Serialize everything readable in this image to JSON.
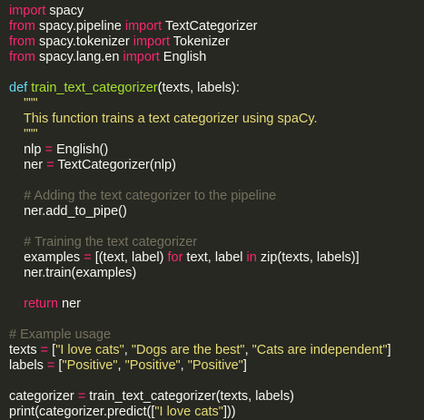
{
  "theme": {
    "background": "#272822",
    "foreground": "#f8f8f2",
    "keyword": "#f92672",
    "storage": "#66d9ef",
    "function": "#a6e22e",
    "string": "#e6db74",
    "comment": "#75715e"
  },
  "code": {
    "lines": [
      [
        {
          "t": "kw",
          "v": "import"
        },
        {
          "t": "pl",
          "v": " spacy"
        }
      ],
      [
        {
          "t": "kw",
          "v": "from"
        },
        {
          "t": "pl",
          "v": " spacy.pipeline "
        },
        {
          "t": "kw",
          "v": "import"
        },
        {
          "t": "pl",
          "v": " TextCategorizer"
        }
      ],
      [
        {
          "t": "kw",
          "v": "from"
        },
        {
          "t": "pl",
          "v": " spacy.tokenizer "
        },
        {
          "t": "kw",
          "v": "import"
        },
        {
          "t": "pl",
          "v": " Tokenizer"
        }
      ],
      [
        {
          "t": "kw",
          "v": "from"
        },
        {
          "t": "pl",
          "v": " spacy.lang.en "
        },
        {
          "t": "kw",
          "v": "import"
        },
        {
          "t": "pl",
          "v": " English"
        }
      ],
      [],
      [
        {
          "t": "def",
          "v": "def"
        },
        {
          "t": "pl",
          "v": " "
        },
        {
          "t": "fn",
          "v": "train_text_categorizer"
        },
        {
          "t": "pl",
          "v": "(texts, labels):"
        }
      ],
      [
        {
          "t": "str",
          "v": "    \"\"\""
        }
      ],
      [
        {
          "t": "str",
          "v": "    This function trains a text categorizer using spaCy."
        }
      ],
      [
        {
          "t": "str",
          "v": "    \"\"\""
        }
      ],
      [
        {
          "t": "pl",
          "v": "    nlp "
        },
        {
          "t": "op",
          "v": "="
        },
        {
          "t": "pl",
          "v": " English()"
        }
      ],
      [
        {
          "t": "pl",
          "v": "    ner "
        },
        {
          "t": "op",
          "v": "="
        },
        {
          "t": "pl",
          "v": " TextCategorizer(nlp)"
        }
      ],
      [],
      [
        {
          "t": "cm",
          "v": "    # Adding the text categorizer to the pipeline"
        }
      ],
      [
        {
          "t": "pl",
          "v": "    ner.add_to_pipe()"
        }
      ],
      [],
      [
        {
          "t": "cm",
          "v": "    # Training the text categorizer"
        }
      ],
      [
        {
          "t": "pl",
          "v": "    examples "
        },
        {
          "t": "op",
          "v": "="
        },
        {
          "t": "pl",
          "v": " [(text, label) "
        },
        {
          "t": "kw",
          "v": "for"
        },
        {
          "t": "pl",
          "v": " text, label "
        },
        {
          "t": "kw",
          "v": "in"
        },
        {
          "t": "pl",
          "v": " zip(texts, labels)]"
        }
      ],
      [
        {
          "t": "pl",
          "v": "    ner.train(examples)"
        }
      ],
      [],
      [
        {
          "t": "pl",
          "v": "    "
        },
        {
          "t": "kw",
          "v": "return"
        },
        {
          "t": "pl",
          "v": " ner"
        }
      ],
      [],
      [
        {
          "t": "cm",
          "v": "# Example usage"
        }
      ],
      [
        {
          "t": "pl",
          "v": "texts "
        },
        {
          "t": "op",
          "v": "="
        },
        {
          "t": "pl",
          "v": " ["
        },
        {
          "t": "str",
          "v": "\"I love cats\""
        },
        {
          "t": "pl",
          "v": ", "
        },
        {
          "t": "str",
          "v": "\"Dogs are the best\""
        },
        {
          "t": "pl",
          "v": ", "
        },
        {
          "t": "str",
          "v": "\"Cats are independent\""
        },
        {
          "t": "pl",
          "v": "]"
        }
      ],
      [
        {
          "t": "pl",
          "v": "labels "
        },
        {
          "t": "op",
          "v": "="
        },
        {
          "t": "pl",
          "v": " ["
        },
        {
          "t": "str",
          "v": "\"Positive\""
        },
        {
          "t": "pl",
          "v": ", "
        },
        {
          "t": "str",
          "v": "\"Positive\""
        },
        {
          "t": "pl",
          "v": ", "
        },
        {
          "t": "str",
          "v": "\"Positive\""
        },
        {
          "t": "pl",
          "v": "]"
        }
      ],
      [],
      [
        {
          "t": "pl",
          "v": "categorizer "
        },
        {
          "t": "op",
          "v": "="
        },
        {
          "t": "pl",
          "v": " train_text_categorizer(texts, labels)"
        }
      ],
      [
        {
          "t": "pl",
          "v": "print(categorizer.predict(["
        },
        {
          "t": "str",
          "v": "\"I love cats\""
        },
        {
          "t": "pl",
          "v": "]))"
        }
      ]
    ]
  }
}
